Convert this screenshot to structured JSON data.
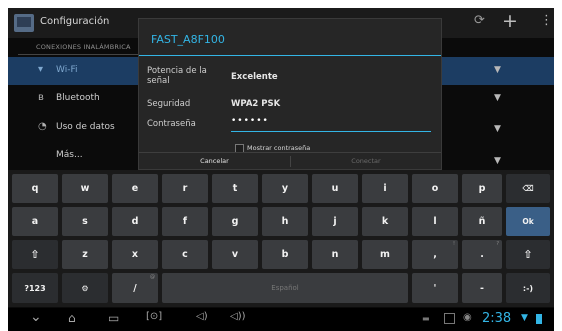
{
  "actionbar": {
    "title": "Configuración",
    "action_icon": "sync-icon",
    "add_symbol": "+",
    "overflow_symbol": "⋮"
  },
  "settings": {
    "section_header": "CONEXIONES INALÁMBRICA",
    "items": [
      {
        "icon": "wifi-icon",
        "glyph": "▾",
        "label": "Wi-Fi",
        "selected": true
      },
      {
        "icon": "bluetooth-icon",
        "glyph": "ʙ",
        "label": "Bluetooth"
      },
      {
        "icon": "data-usage-icon",
        "glyph": "◔",
        "label": "Uso de datos"
      },
      {
        "icon": "",
        "glyph": "",
        "label": "Más..."
      }
    ]
  },
  "dialog": {
    "title": "FAST_A8F100",
    "signal_label": "Potencia de la señal",
    "signal_value": "Excelente",
    "security_label": "Seguridad",
    "security_value": "WPA2 PSK",
    "password_label": "Contraseña",
    "password_value": "••••••",
    "show_password_label": "Mostrar contraseña",
    "show_password_checked": false,
    "cancel_label": "Cancelar",
    "connect_label": "Conectar"
  },
  "keyboard": {
    "row1": [
      "q",
      "w",
      "e",
      "r",
      "t",
      "y",
      "u",
      "i",
      "o",
      "p"
    ],
    "row2": [
      "a",
      "s",
      "d",
      "f",
      "g",
      "h",
      "j",
      "k",
      "l",
      "ñ"
    ],
    "row3": [
      "z",
      "x",
      "c",
      "v",
      "b",
      "n",
      "m"
    ],
    "delete_glyph": "⌫",
    "enter_label": "Ok",
    "shift_glyph": "⇧",
    "comma": ",",
    "period": ".",
    "symbols_label": "?123",
    "settings_glyph": "⚙",
    "slash": "/",
    "space_label": "Español",
    "apostrophe": "'",
    "dash": "-",
    "smiley": ":-)",
    "comma_hint": "!",
    "period_hint": "?",
    "slash_hint": "@"
  },
  "navbar": {
    "back_glyph": "⌄",
    "home_glyph": "⌂",
    "recents_glyph": "▭",
    "screenshot_glyph": "[⊙]",
    "vol_down_glyph": "◁)",
    "vol_up_glyph": "◁))",
    "time": "2:38"
  },
  "colors": {
    "accent": "#33b5e5",
    "selected_row": "#1c3d63",
    "key": "#3a3c3f",
    "enter_key": "#3a5f87"
  }
}
